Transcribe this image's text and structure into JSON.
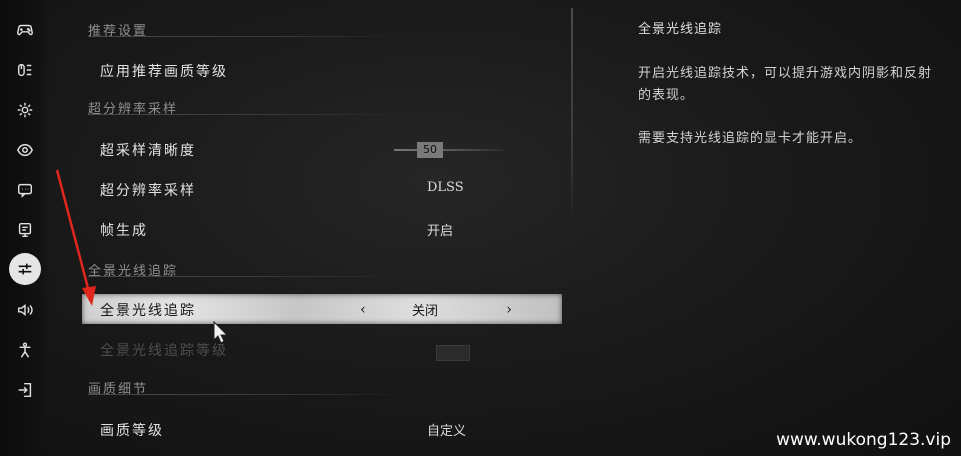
{
  "sidebar": {
    "icons": [
      {
        "name": "gamepad-icon"
      },
      {
        "name": "keyboard-icon"
      },
      {
        "name": "gear-icon"
      },
      {
        "name": "eye-icon"
      },
      {
        "name": "chat-icon"
      },
      {
        "name": "monitor-icon"
      },
      {
        "name": "sliders-icon",
        "active": true
      },
      {
        "name": "speaker-icon"
      },
      {
        "name": "accessibility-icon"
      },
      {
        "name": "exit-icon"
      }
    ]
  },
  "sections": {
    "recommended": "推荐设置",
    "super_resolution": "超分辨率采样",
    "ray_tracing": "全景光线追踪",
    "quality_detail": "画质细节"
  },
  "rows": {
    "apply_recommended": {
      "label": "应用推荐画质等级"
    },
    "sampling_sharpness": {
      "label": "超采样清晰度",
      "value": "50"
    },
    "super_resolution": {
      "label": "超分辨率采样",
      "value": "DLSS"
    },
    "frame_gen": {
      "label": "帧生成",
      "value": "开启"
    },
    "ray_tracing": {
      "label": "全景光线追踪",
      "value": "关闭"
    },
    "ray_tracing_level": {
      "label": "全景光线追踪等级"
    },
    "quality_level": {
      "label": "画质等级",
      "value": "自定义"
    }
  },
  "chevrons": {
    "left": "‹",
    "right": "›"
  },
  "description": {
    "title": "全景光线追踪",
    "body": "开启光线追踪技术，可以提升游戏内阴影和反射的表现。",
    "note": "需要支持光线追踪的显卡才能开启。"
  },
  "watermark": "www.wukong123.vip",
  "colors": {
    "annotation_arrow": "#e0261c",
    "highlight": "#d6d6d6"
  }
}
